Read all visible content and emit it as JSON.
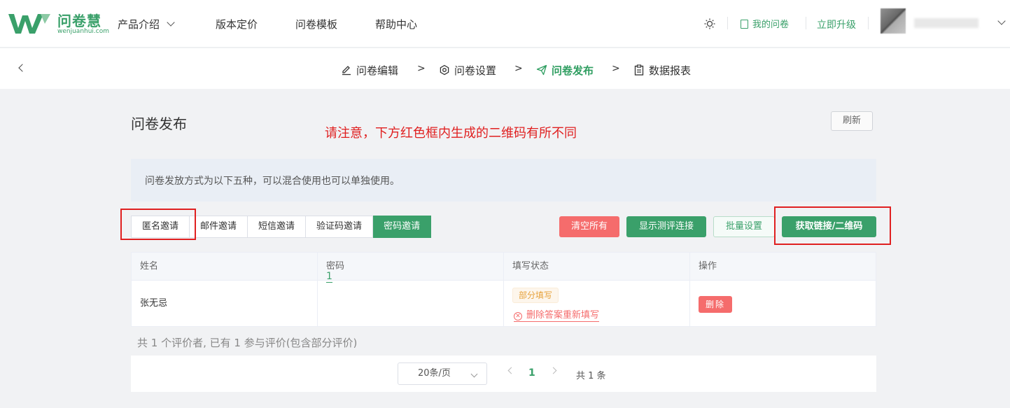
{
  "brand": {
    "name": "问卷慧",
    "domain": "wenjuanhui.com",
    "color": "#3aa06a"
  },
  "nav": {
    "items": [
      {
        "label": "产品介绍"
      },
      {
        "label": "版本定价"
      },
      {
        "label": "问卷模板"
      },
      {
        "label": "帮助中心"
      }
    ],
    "my_surveys": "我的问卷",
    "upgrade": "立即升级"
  },
  "steps": [
    {
      "label": "问卷编辑",
      "icon": "edit-icon"
    },
    {
      "label": "问卷设置",
      "icon": "settings-icon"
    },
    {
      "label": "问卷发布",
      "icon": "send-icon",
      "active": true
    },
    {
      "label": "数据报表",
      "icon": "clipboard-icon"
    }
  ],
  "step_separator": ">",
  "page": {
    "title": "问卷发布",
    "notice": "请注意，下方红色框内生成的二维码有所不同",
    "refresh": "刷新",
    "info": "问卷发放方式为以下五种，可以混合使用也可以单独使用。"
  },
  "tabs": [
    {
      "label": "匿名邀请"
    },
    {
      "label": "邮件邀请"
    },
    {
      "label": "短信邀请"
    },
    {
      "label": "验证码邀请"
    },
    {
      "label": "密码邀请",
      "active": true
    }
  ],
  "actions": {
    "clear_all": "清空所有",
    "show_test_link": "显示测评连接",
    "batch_settings": "批量设置",
    "get_link_qr": "获取链接/二维码"
  },
  "table": {
    "headers": [
      "姓名",
      "密码",
      "填写状态",
      "操作"
    ],
    "rows": [
      {
        "name": "张无忌",
        "password": "1",
        "status": "部分填写",
        "reset": "删除答案重新填写",
        "delete": "删除"
      }
    ]
  },
  "summary": "共 1 个评价者, 已有 1 参与评价(包含部分评价)",
  "pagination": {
    "page_size": "20条/页",
    "current": "1",
    "total": "共 1 条"
  },
  "colors": {
    "primary": "#3aa06a",
    "danger": "#f56c6c",
    "warning": "#e6a23c",
    "highlight": "#e02020"
  }
}
